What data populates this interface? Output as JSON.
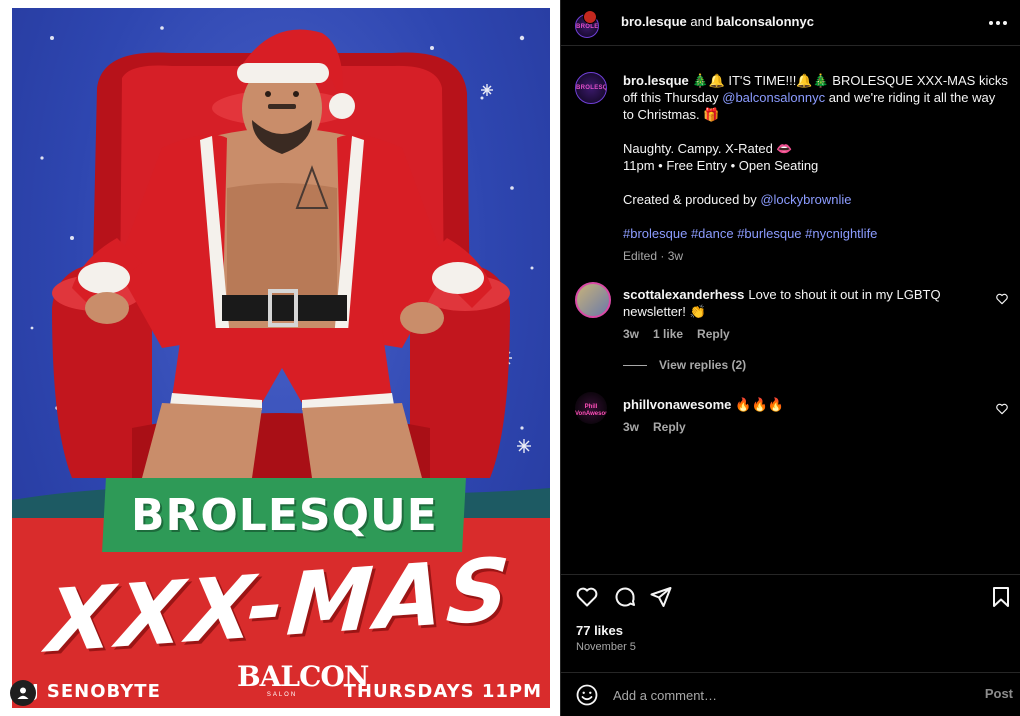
{
  "poster": {
    "brand": "BROLESQUE",
    "event": "XXX-MAS",
    "dj": "DJ SENOBYTE",
    "venue": "BALCON",
    "venue_sub": "SALON",
    "when": "THURSDAYS 11PM"
  },
  "header": {
    "account": "bro.lesque",
    "and": "and",
    "collaborator": "balconsalonnyc",
    "avatar_text": "BROLESQUE"
  },
  "caption": {
    "username": "bro.lesque",
    "line1a": " 🎄🔔 IT'S TIME!!!🔔🎄 BROLESQUE XXX-MAS kicks off this Thursday ",
    "mention1": "@balconsalonnyc",
    "line1b": " and we're riding it all the way to Christmas. 🎁",
    "line2": "Naughty. Campy. X-Rated 👄",
    "line3": "11pm • Free Entry • Open Seating",
    "line4a": "Created & produced by ",
    "mention2": "@lockybrownlie",
    "hashtags": "#brolesque #dance #burlesque #nycnightlife",
    "meta": "Edited · 3w"
  },
  "comments": [
    {
      "username": "scottalexanderhess",
      "text": "Love to shout it out in my LGBTQ newsletter! 👏",
      "time": "3w",
      "likes": "1 like",
      "reply": "Reply"
    },
    {
      "username": "phillvonawesome",
      "text": "🔥🔥🔥",
      "time": "3w",
      "reply": "Reply",
      "avatar_text": "Phill VonAwesome"
    }
  ],
  "view_replies": "View replies (2)",
  "actions": {
    "likes": "77 likes",
    "date": "November 5"
  },
  "composer": {
    "placeholder": "Add a comment…",
    "post": "Post"
  },
  "colors": {
    "link": "#8c9cff",
    "poster_blue": "#2e46b0",
    "poster_red": "#d92c2c",
    "poster_green": "#2e9a57"
  }
}
